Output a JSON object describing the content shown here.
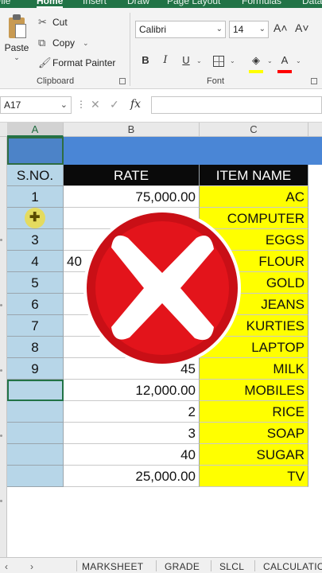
{
  "ribbon_tabs": [
    "File",
    "Home",
    "Insert",
    "Draw",
    "Page Layout",
    "Formulas",
    "Data"
  ],
  "clipboard": {
    "paste_label": "Paste",
    "cut_label": "Cut",
    "copy_label": "Copy",
    "format_painter_label": "Format Painter",
    "group_label": "Clipboard"
  },
  "font": {
    "name": "Calibri",
    "size": "14",
    "group_label": "Font",
    "bold": "B",
    "italic": "I",
    "underline": "U",
    "grow": "A˄",
    "shrink": "A˅",
    "fill_color": "#ffff00",
    "font_color": "#ff0000"
  },
  "formula_bar": {
    "name_box": "A17",
    "fx": "fx",
    "value": ""
  },
  "columns": [
    "A",
    "B",
    "C"
  ],
  "table": {
    "headers": {
      "sno": "S.NO.",
      "rate": "RATE",
      "item": "ITEM NAME"
    },
    "rows": [
      {
        "sno": "1",
        "rate": "75,000.00",
        "item": "AC"
      },
      {
        "sno": "",
        "rate": "",
        "item": "COMPUTER"
      },
      {
        "sno": "3",
        "rate": "",
        "item": "EGGS"
      },
      {
        "sno": "4",
        "rate": "40",
        "item": "FLOUR"
      },
      {
        "sno": "5",
        "rate": "",
        "item": "GOLD"
      },
      {
        "sno": "6",
        "rate": "",
        "item": "JEANS"
      },
      {
        "sno": "7",
        "rate": "",
        "item": "KURTIES"
      },
      {
        "sno": "8",
        "rate": "",
        "item": "LAPTOP"
      },
      {
        "sno": "9",
        "rate": "45",
        "item": "MILK"
      },
      {
        "sno": "",
        "rate": "12,000.00",
        "item": "MOBILES"
      },
      {
        "sno": "",
        "rate": "2",
        "item": "RICE"
      },
      {
        "sno": "",
        "rate": "3",
        "item": "SOAP"
      },
      {
        "sno": "",
        "rate": "40",
        "item": "SUGAR"
      },
      {
        "sno": "",
        "rate": "25,000.00",
        "item": "TV"
      }
    ]
  },
  "sheet_tabs": [
    "MARKSHEET",
    "GRADE",
    "SLCL",
    "CALCULATION"
  ],
  "accent": "#217346",
  "x_badge_color": "#e3141b"
}
